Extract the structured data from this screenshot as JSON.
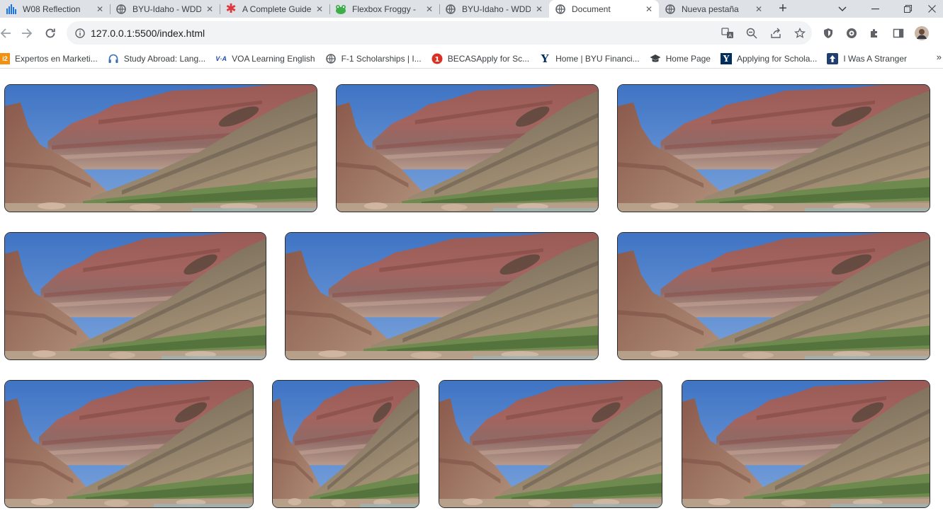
{
  "browser": {
    "tabs": [
      {
        "title": "W08 Reflection",
        "icon": "bar-chart-icon"
      },
      {
        "title": "BYU-Idaho - WDD",
        "icon": "globe-icon"
      },
      {
        "title": "A Complete Guide",
        "icon": "asterisk-icon"
      },
      {
        "title": "Flexbox Froggy -",
        "icon": "frog-icon"
      },
      {
        "title": "BYU-Idaho - WDD",
        "icon": "globe-icon"
      },
      {
        "title": "Document",
        "icon": "globe-icon",
        "active": true
      },
      {
        "title": "Nueva pestaña",
        "icon": "globe-icon"
      }
    ],
    "new_tab_label": "+",
    "url": "127.0.0.1:5500/index.html",
    "bookmarks": [
      {
        "label": "Expertos en Marketi...",
        "icon": "marketing-icon"
      },
      {
        "label": "Study Abroad: Lang...",
        "icon": "headset-icon"
      },
      {
        "label": "VOA Learning English",
        "icon": "voa-icon"
      },
      {
        "label": "F-1 Scholarships | I...",
        "icon": "globe-icon"
      },
      {
        "label": "BECASApply for Sc...",
        "icon": "becas-icon"
      },
      {
        "label": "Home | BYU Financi...",
        "icon": "y-logo-icon"
      },
      {
        "label": "Home Page",
        "icon": "graduation-cap-icon"
      },
      {
        "label": "Applying for Schola...",
        "icon": "y-logo-icon"
      },
      {
        "label": "I Was A Stranger",
        "icon": "arrow-up-icon"
      }
    ],
    "bookmarks_overflow": "»"
  },
  "gallery": {
    "rows": [
      {
        "count": 3
      },
      {
        "count": 3
      },
      {
        "count": 4
      }
    ],
    "photo_subject": "canyon-landscape"
  }
}
